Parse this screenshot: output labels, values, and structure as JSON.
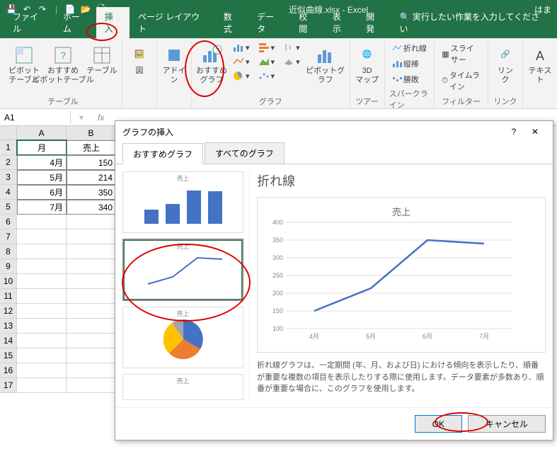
{
  "app": {
    "title": "近似曲線.xlsx - Excel",
    "user": "はま"
  },
  "qat": {
    "save": "💾",
    "undo": "↶",
    "redo": "↷"
  },
  "tabs": {
    "file": "ファイル",
    "home": "ホーム",
    "insert": "挿入",
    "pagelayout": "ページ レイアウト",
    "formulas": "数式",
    "data": "データ",
    "review": "校閲",
    "view": "表示",
    "developer": "開発",
    "tellme": "実行したい作業を入力してください"
  },
  "ribbon": {
    "pivot": "ピボット\nテーブル",
    "recpivot": "おすすめ\nピボットテーブル",
    "table": "テーブル",
    "illustrations": "図",
    "addins": "アドイ\nン",
    "recchart": "おすすめ\nグラフ",
    "pivotchart": "ピボットグラフ",
    "map3d": "3D\nマップ",
    "sparkline1": "折れ線",
    "sparkline2": "縦棒",
    "sparkline3": "勝敗",
    "slicer": "スライサー",
    "timeline": "タイムライン",
    "link": "リン\nク",
    "text": "テキス\nト",
    "g_tables": "テーブル",
    "g_chart": "グラフ",
    "g_tour": "ツアー",
    "g_spark": "スパークライン",
    "g_filter": "フィルター",
    "g_link": "リンク"
  },
  "namebox": "A1",
  "sheet": {
    "colA": "A",
    "colB": "B",
    "header_month": "月",
    "header_sales": "売上",
    "rows": [
      {
        "month": "4月",
        "sales": "150"
      },
      {
        "month": "5月",
        "sales": "214"
      },
      {
        "month": "6月",
        "sales": "350"
      },
      {
        "month": "7月",
        "sales": "340"
      }
    ]
  },
  "dialog": {
    "title": "グラフの挿入",
    "help": "?",
    "close": "✕",
    "tab_rec": "おすすめグラフ",
    "tab_all": "すべてのグラフ",
    "chart_type": "折れ線",
    "preview_title": "売上",
    "desc": "折れ線グラフは、一定期間 (年、月、および日) における傾向を表示したり、順番が重要な複数の項目を表示したりする際に使用します。データ要素が多数あり、順番が重要な場合に、このグラフを使用します。",
    "ok": "OK",
    "cancel": "キャンセル",
    "thumb_title": "売上"
  },
  "chart_data": {
    "type": "line",
    "categories": [
      "4月",
      "5月",
      "6月",
      "7月"
    ],
    "values": [
      150,
      214,
      350,
      340
    ],
    "title": "売上",
    "xlabel": "",
    "ylabel": "",
    "ylim": [
      100,
      400
    ],
    "yticks": [
      100,
      150,
      200,
      250,
      300,
      350,
      400
    ]
  }
}
